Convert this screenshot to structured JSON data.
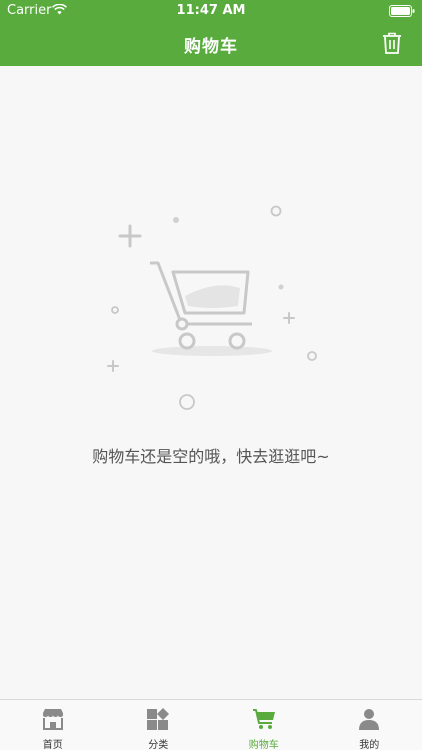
{
  "status_bar": {
    "carrier": "Carrier",
    "time": "11:47 AM"
  },
  "nav": {
    "title": "购物车",
    "trash_icon": "trash-icon"
  },
  "empty_state": {
    "message": "购物车还是空的哦，快去逛逛吧~",
    "illustration": "empty-cart-illustration"
  },
  "tabbar": {
    "active_color": "#5aab3e",
    "items": [
      {
        "label": "首页",
        "icon": "storefront-icon"
      },
      {
        "label": "分类",
        "icon": "category-grid-icon"
      },
      {
        "label": "购物车",
        "icon": "cart-icon"
      },
      {
        "label": "我的",
        "icon": "user-icon"
      }
    ]
  }
}
